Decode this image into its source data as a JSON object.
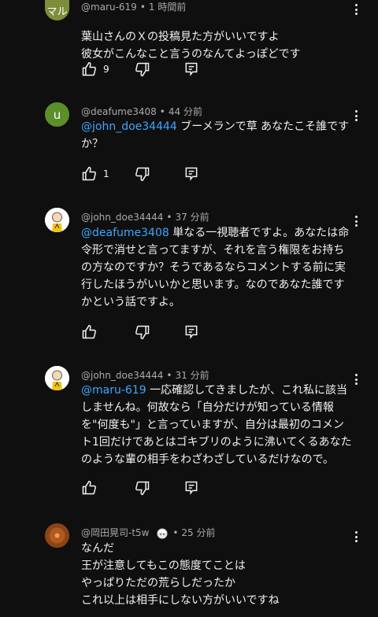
{
  "comments": [
    {
      "avatar_text": "マル",
      "avatar_color": "#7c8e3a",
      "handle": "@maru-619",
      "time": "1 時間前",
      "lines": [
        "葉山さんのＸの投稿見た方がいいですよ",
        "彼女がこんなこと言うのなんてよっぽどです"
      ],
      "likes": "9"
    },
    {
      "avatar_text": "u",
      "avatar_color": "#5a8f2a",
      "handle": "@deafume3408",
      "time": "44 分前",
      "mention": "@john_doe34444",
      "text": " ブーメランで草 あなたこそ誰ですか？",
      "likes": "1"
    },
    {
      "handle": "@john_doe34444",
      "time": "37 分前",
      "mention": "@deafume3408",
      "text": " 単なる一視聴者ですよ。あなたは命令形で消せと言ってますが、それを言う権限をお持ちの方なのですか？そうであるならコメントする前に実行したほうがいいかと思います。なのであなた誰ですかという話ですよ。",
      "likes": ""
    },
    {
      "handle": "@john_doe34444",
      "time": "31 分前",
      "mention": "@maru-619",
      "text": " 一応確認してきましたが、これ私に該当しませんね。何故なら「自分だけが知っている情報を\"何度も\"」と言っていますが、自分は最初のコメント1回だけであとはゴキブリのように沸いてくるあなたのような輩の相手をわざわざしているだけなので。",
      "likes": ""
    },
    {
      "handle": "@岡田晃司-t5w",
      "time": "25 分前",
      "lines": [
        "なんだ",
        "王が注意してもこの態度てことは",
        "やっぱりただの荒らしだったか",
        "これ以上は相手にしない方がいいですね"
      ]
    }
  ],
  "icons": {
    "like": "thumbs-up-icon",
    "dislike": "thumbs-down-icon",
    "reply": "reply-icon",
    "more": "more-vertical-icon"
  },
  "colors": {
    "mention": "#3ea6ff",
    "meta": "#aaaaaa",
    "background": "#0f0f0f"
  }
}
